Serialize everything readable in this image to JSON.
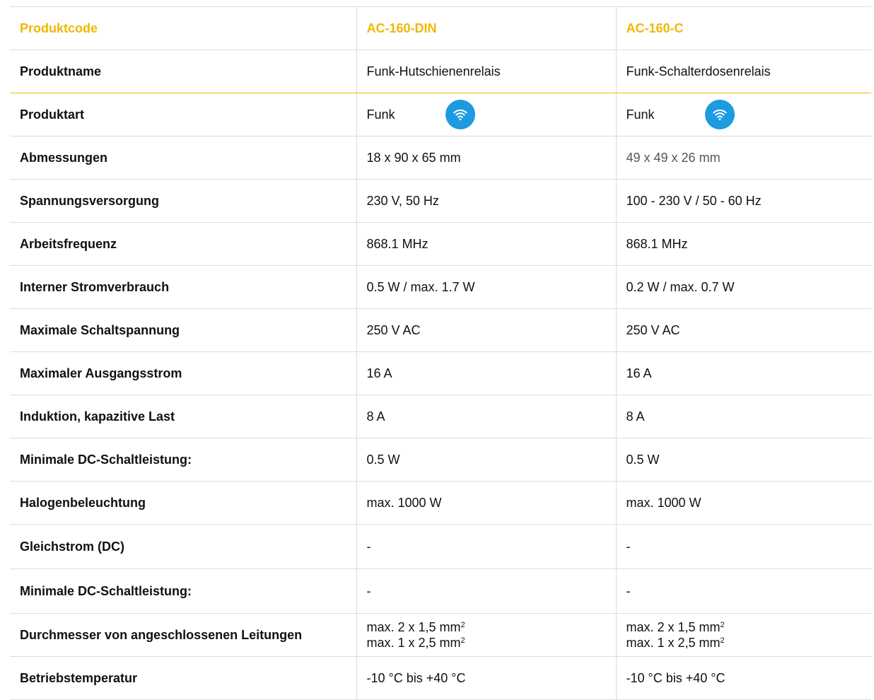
{
  "colors": {
    "accent": "#f2b705",
    "wifi_badge": "#1c9be0",
    "border": "#dcdcdc"
  },
  "header": {
    "label": "Produktcode",
    "col1": "AC-160-DIN",
    "col2": "AC-160-C"
  },
  "rows": [
    {
      "label": "Produktname",
      "col1": "Funk-Hutschienenrelais",
      "col2": "Funk-Schalterdosenrelais"
    },
    {
      "label": "Produktart",
      "col1": "Funk",
      "col2": "Funk",
      "icon": "wifi-icon"
    },
    {
      "label": "Abmessungen",
      "col1": "18 x 90 x 65 mm",
      "col2": "49 x 49 x 26 mm"
    },
    {
      "label": "Spannungsversorgung",
      "col1": "230 V, 50 Hz",
      "col2": "100 - 230 V / 50 - 60 Hz"
    },
    {
      "label": "Arbeitsfrequenz",
      "col1": "868.1 MHz",
      "col2": "868.1 MHz"
    },
    {
      "label": "Interner Stromverbrauch",
      "col1": "0.5 W / max. 1.7 W",
      "col2": "0.2 W / max. 0.7 W"
    },
    {
      "label": "Maximale Schaltspannung",
      "col1": "250 V AC",
      "col2": "250 V AC"
    },
    {
      "label": "Maximaler Ausgangsstrom",
      "col1": "16 A",
      "col2": "16 A"
    },
    {
      "label": "Induktion, kapazitive Last",
      "col1": "8 A",
      "col2": "8 A"
    },
    {
      "label": "Minimale DC-Schaltleistung:",
      "col1": "0.5 W",
      "col2": "0.5 W"
    },
    {
      "label": "Halogenbeleuchtung",
      "col1": "max. 1000 W",
      "col2": "max. 1000 W"
    },
    {
      "label": "Gleichstrom (DC)",
      "col1": "-",
      "col2": "-"
    },
    {
      "label": "Minimale DC-Schaltleistung:",
      "col1": "-",
      "col2": "-"
    },
    {
      "label": "Durchmesser von angeschlossenen Leitungen",
      "col1": [
        "max. 2 x 1,5 mm",
        "max. 1 x 2,5 mm"
      ],
      "col2": [
        "max. 2 x 1,5 mm",
        "max. 1 x 2,5 mm"
      ],
      "unit_superscript": "2"
    },
    {
      "label": "Betriebstemperatur",
      "col1": "-10 °C bis +40 °C",
      "col2": "-10 °C bis +40 °C"
    }
  ]
}
